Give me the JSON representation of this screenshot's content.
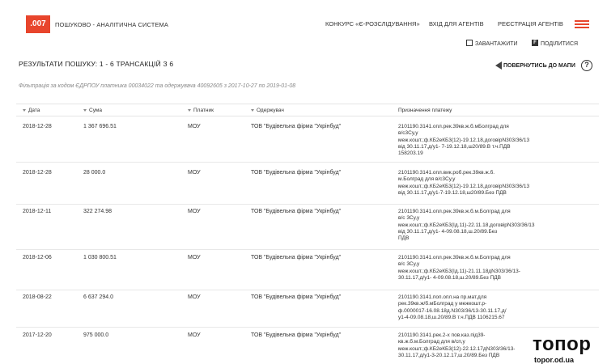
{
  "header": {
    "logo": ".007",
    "brand": "ПОШУКОВО - АНАЛІТИЧНА СИСТЕМА",
    "nav": [
      "КОНКУРС «Є-РОЗСЛІДУВАННЯ»",
      "ВХІД ДЛЯ АГЕНТІВ",
      "РЕЄСТРАЦІЯ АГЕНТІВ"
    ],
    "menu_icon": "hamburger-icon",
    "accent_color": "#e8452c"
  },
  "toolbar": {
    "download": "ЗАВАНТАЖИТИ",
    "share": "ПОДІЛИТИСЯ"
  },
  "results": {
    "title": "РЕЗУЛЬТАТИ ПОШУКУ: 1 - 6 трансакцій з 6",
    "back": "ПОВЕРНУТИСЬ ДО МАПИ",
    "help": "?",
    "filter": "Фільтрація за кодом ЄДРПОУ платника 00034022 та одержувача 40092605 з 2017-10-27 по 2019-01-08"
  },
  "table": {
    "columns": [
      "Дата",
      "Сума",
      "Платник",
      "Одержувач",
      "Призначення платежу"
    ],
    "rows": [
      {
        "date": "2018-12-28",
        "amount": "1 367 696.51",
        "payer": "МОУ",
        "payee": "ТОВ \"Будівельна фірма \"Укрінбуд\"",
        "purpose": [
          "2101190.3141.опл.рек.39кв.ж.б.мБолград для",
          "в/с3Су,у",
          "меж.кошт.;ф.КБ2еКБ3(12)-19.12.18,договірN303/36/13",
          "від 30.11.17,д/у1- 7-19.12.18,ш20/89.В т.ч.ПДВ",
          "158203.19"
        ]
      },
      {
        "date": "2018-12-28",
        "amount": "28 000.0",
        "payer": "МОУ",
        "payee": "ТОВ \"Будівельна фірма \"Укрінбуд\"",
        "purpose": [
          "2101190.3141.опл.вик.роб.рек.39кв.ж.б.",
          "м.Болград для в/с3Су,у",
          "меж.кошт.;ф.КБ2еКБ3(12)-19.12.18,договірN303/36/13",
          "від 30.11.17,д/у1-7-19.12.18,ш20/89.Без ПДВ"
        ]
      },
      {
        "date": "2018-12-11",
        "amount": "322 274.98",
        "payer": "МОУ",
        "payee": "ТОВ \"Будівельна фірма \"Укрінбуд\"",
        "purpose": [
          "2101190.3141.опл.рек.39кв.ж.б.м.Болград для",
          "в/с 3Су,у",
          "меж.кошт.;ф.КБ2еКБ3(Ід.11)-22.11.18,договірN303/36/13",
          "від 30.11.17,д/у1- 4-09.08.18,ш.20/89.Без",
          "ПДВ"
        ]
      },
      {
        "date": "2018-12-06",
        "amount": "1 030 800.51",
        "payer": "МОУ",
        "payee": "ТОВ \"Будівельна фірма \"Укрінбуд\"",
        "purpose": [
          "2101190.3141.опл.рек.39кв.ж.б.м.Болград для",
          "в/с 3Су,у",
          "меж.кошт.;ф.КБ2еКБ3(Ід.11)-21.11.18дN303/36/13-",
          "30.11.17,д/у1- 4-09.08.18,ш.20/89.Без ПДВ"
        ]
      },
      {
        "date": "2018-08-22",
        "amount": "6 637 294.0",
        "payer": "МОУ",
        "payee": "ТОВ \"Будівельна фірма \"Укрінбуд\"",
        "purpose": [
          "2101190.3141.поп.опл.на пр.мат.для",
          "рек.39кв.ж/б.мБолград у межкошт.р-",
          "ф.0000017-16.08.18д.N303/36/13-30.11.17,д/",
          "у1-4-09.08.18,ш.20/89.В т.ч.ПДВ 1106215.67"
        ]
      },
      {
        "date": "2017-12-20",
        "amount": "975 000.0",
        "payer": "МОУ",
        "payee": "ТОВ \"Будівельна фірма \"Укрінбуд\"",
        "purpose": [
          "2101190.3141.рек.2-х пов.каз.під39-",
          "кв.ж.б.м.Болград для в/сп,у",
          "меж.кошт.;ф.КБ2еКБ3(12)-22.12.17дN303/36/13-",
          "30.11.17,д/у1-3-20.12.17,ш.20/89.Без ПДВ"
        ]
      }
    ]
  },
  "watermark": {
    "big": "топор",
    "small": "topor.od.ua"
  }
}
